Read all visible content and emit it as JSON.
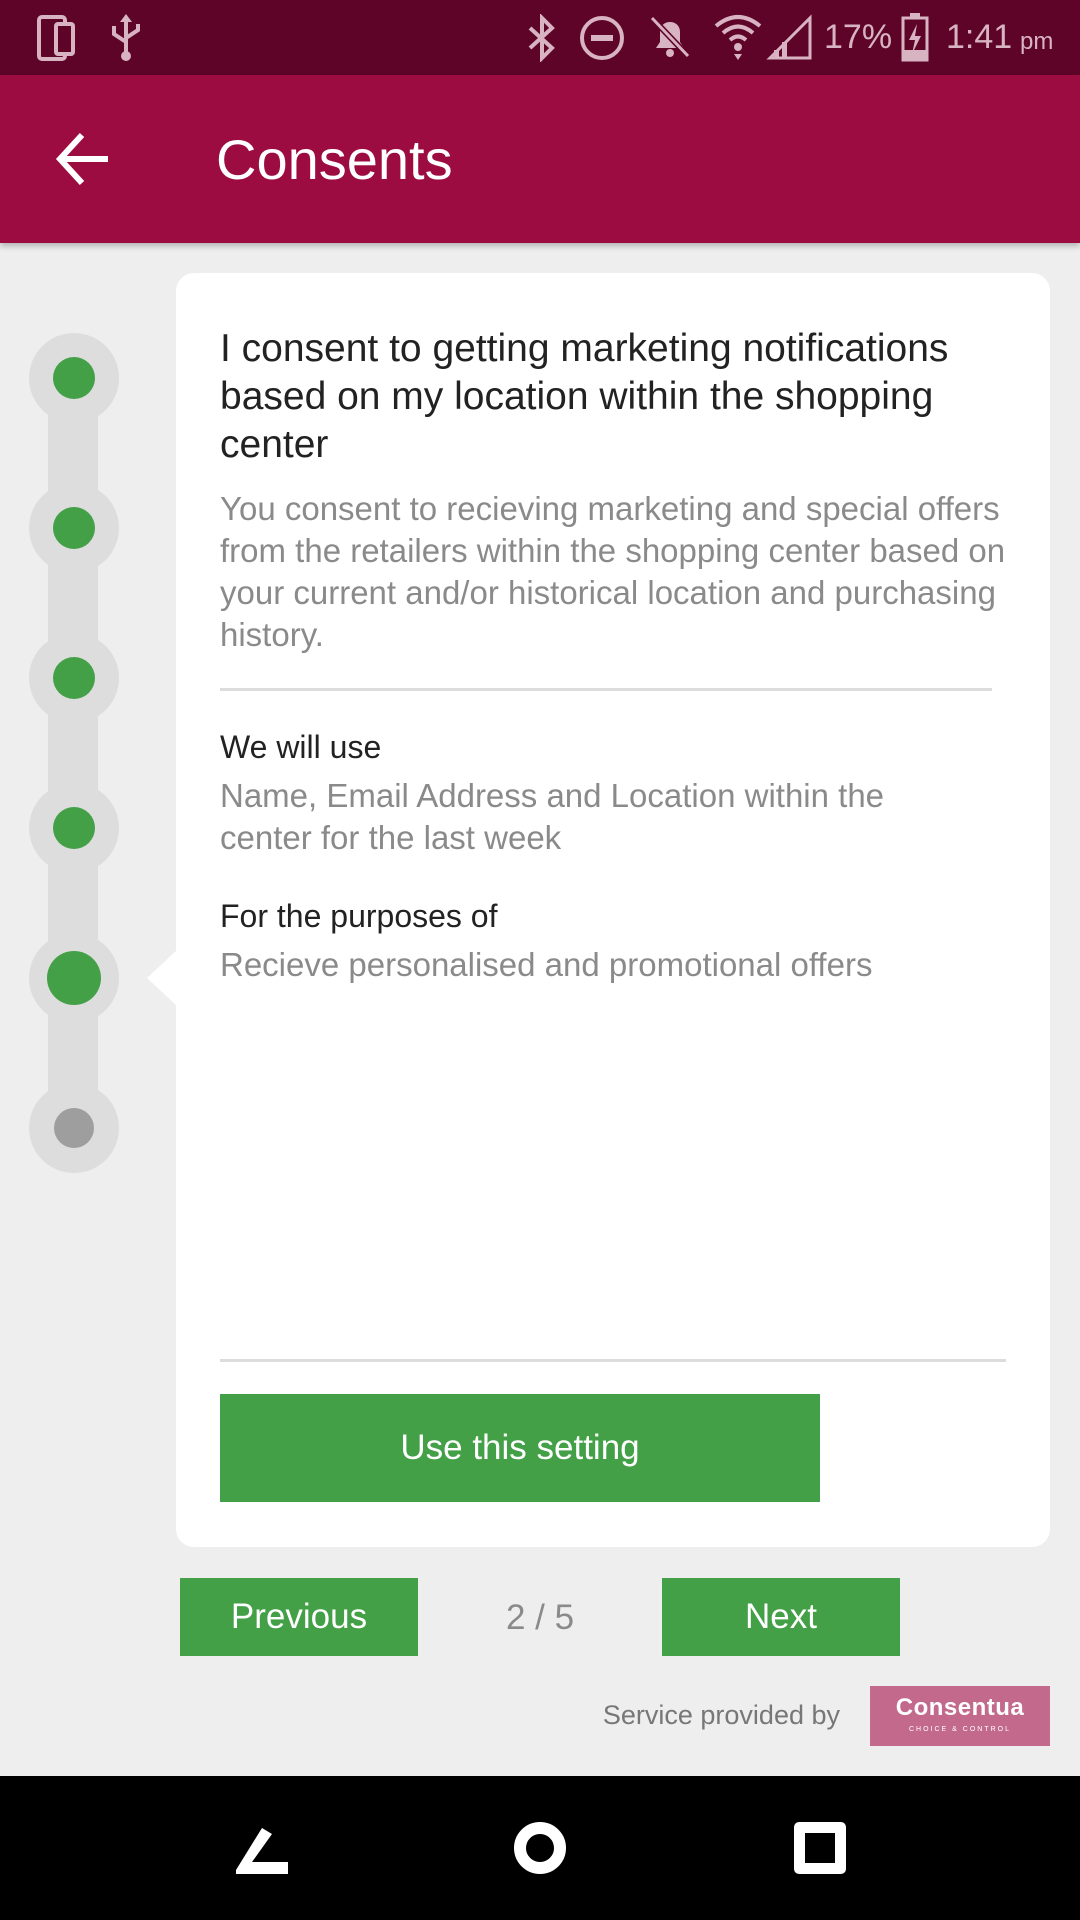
{
  "status_bar": {
    "battery_percent": "17%",
    "time": "1:41",
    "time_suffix": "pm",
    "icons": [
      "phone-device-icon",
      "usb-icon",
      "bluetooth-icon",
      "do-not-disturb-icon",
      "notifications-off-icon",
      "wifi-icon",
      "signal-icon",
      "battery-charging-icon"
    ]
  },
  "appbar": {
    "title": "Consents",
    "back_icon": "arrow-left-icon"
  },
  "progress": {
    "total_steps": 6,
    "completed_steps": 4,
    "current_step": 5
  },
  "consent": {
    "title": "I consent to getting marketing notifications based on my location within the shopping center",
    "description": "You consent to recieving marketing and special offers from the retailers within the shopping center based on your current and/or historical location and purchasing history.",
    "use_label": "We will use",
    "use_value": "Name, Email Address and Location within the center for the last week",
    "purpose_label": "For the purposes of",
    "purpose_value": "Recieve personalised and promotional offers",
    "button_label": "Use this setting"
  },
  "pager": {
    "previous_label": "Previous",
    "count": "2 / 5",
    "next_label": "Next"
  },
  "footer": {
    "service_text": "Service provided by",
    "logo_word": "Consentua",
    "logo_tagline": "CHOICE & CONTROL"
  },
  "colors": {
    "status_bar": "#5e0429",
    "app_bar": "#9c0c41",
    "accent_green": "#43a047",
    "pending_grey": "#9e9e9e",
    "logo_bg": "#c36a8c"
  },
  "navbar": {
    "icons": [
      "back-nav-icon",
      "home-nav-icon",
      "recents-nav-icon"
    ]
  }
}
